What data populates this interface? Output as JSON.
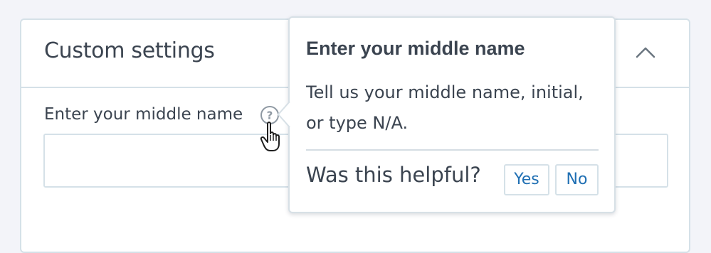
{
  "panel": {
    "title": "Custom settings"
  },
  "field": {
    "label": "Enter your middle name",
    "value": "",
    "help_glyph": "?"
  },
  "popover": {
    "title": "Enter your middle name",
    "body": "Tell us your middle name, initial, or type N/A.",
    "feedback_question": "Was this helpful?",
    "yes_label": "Yes",
    "no_label": "No"
  },
  "icons": {
    "collapse": "chevron-up-icon",
    "help": "question-circle-icon",
    "cursor": "hand-pointer-icon"
  },
  "colors": {
    "text": "#3b4450",
    "link": "#1f6fb3",
    "border": "#d5e1e8",
    "background": "#f3f4f9"
  }
}
